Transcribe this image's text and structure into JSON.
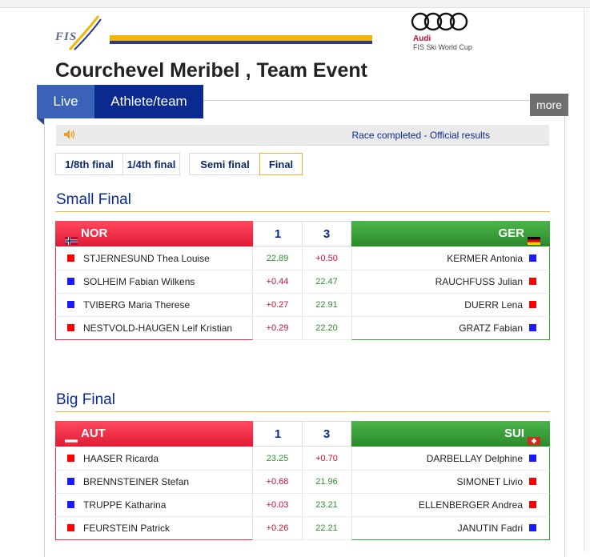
{
  "header": {
    "fis_text": "FIS",
    "audi_brand": "Audi",
    "audi_sub": "FIS Ski World Cup",
    "title": "Courchevel Meribel , Team Event"
  },
  "tabs": {
    "live": "Live",
    "athlete": "Athlete/team",
    "more": "more"
  },
  "status": {
    "text": "Race completed - Official results",
    "icon": "speaker-icon"
  },
  "rounds": [
    "1/8th final",
    "1/4th final",
    "Semi final",
    "Final"
  ],
  "active_round": "Final",
  "runs": {
    "run1": "1",
    "run3": "3"
  },
  "colors": {
    "square_red": "#ff0000",
    "square_blue": "#1a1aff",
    "accent": "#0a2a8f",
    "gold": "#f0b030"
  },
  "small_final": {
    "title": "Small Final",
    "left_team": "NOR",
    "right_team": "GER",
    "rows": [
      {
        "left_name": "STJERNESUND Thea Louise",
        "left_color": "red",
        "v1": "22.89",
        "v1_color": "green",
        "v3": "+0.50",
        "v3_color": "red",
        "right_name": "KERMER Antonia",
        "right_color": "blue"
      },
      {
        "left_name": "SOLHEIM Fabian Wilkens",
        "left_color": "blue",
        "v1": "+0.44",
        "v1_color": "red",
        "v3": "22.47",
        "v3_color": "green",
        "right_name": "RAUCHFUSS Julian",
        "right_color": "red"
      },
      {
        "left_name": "TVIBERG Maria Therese",
        "left_color": "blue",
        "v1": "+0.27",
        "v1_color": "red",
        "v3": "22.91",
        "v3_color": "green",
        "right_name": "DUERR Lena",
        "right_color": "red"
      },
      {
        "left_name": "NESTVOLD-HAUGEN Leif Kristian",
        "left_color": "red",
        "v1": "+0.29",
        "v1_color": "red",
        "v3": "22.20",
        "v3_color": "green",
        "right_name": "GRATZ Fabian",
        "right_color": "blue"
      }
    ]
  },
  "big_final": {
    "title": "Big Final",
    "left_team": "AUT",
    "right_team": "SUI",
    "rows": [
      {
        "left_name": "HAASER Ricarda",
        "left_color": "red",
        "v1": "23.25",
        "v1_color": "green",
        "v3": "+0.70",
        "v3_color": "red",
        "right_name": "DARBELLAY Delphine",
        "right_color": "blue"
      },
      {
        "left_name": "BRENNSTEINER Stefan",
        "left_color": "blue",
        "v1": "+0.68",
        "v1_color": "red",
        "v3": "21.96",
        "v3_color": "green",
        "right_name": "SIMONET Livio",
        "right_color": "red"
      },
      {
        "left_name": "TRUPPE Katharina",
        "left_color": "blue",
        "v1": "+0.03",
        "v1_color": "red",
        "v3": "23.21",
        "v3_color": "green",
        "right_name": "ELLENBERGER Andrea",
        "right_color": "red"
      },
      {
        "left_name": "FEURSTEIN Patrick",
        "left_color": "red",
        "v1": "+0.26",
        "v1_color": "red",
        "v3": "22.21",
        "v3_color": "green",
        "right_name": "JANUTIN Fadri",
        "right_color": "blue"
      }
    ]
  }
}
